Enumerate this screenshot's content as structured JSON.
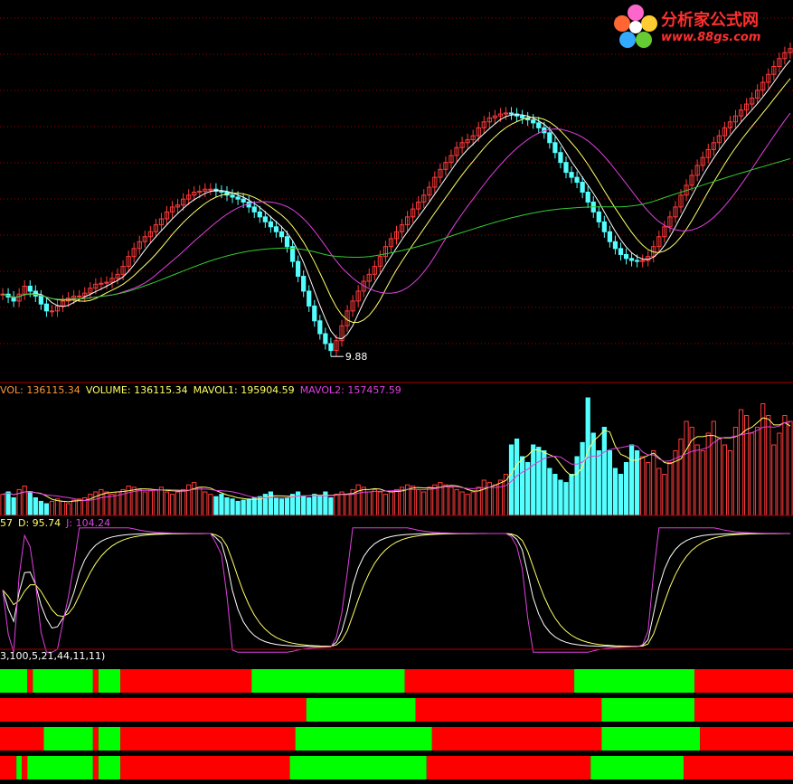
{
  "logo": {
    "title": "分析家公式网",
    "url": "www.88gs.com"
  },
  "colors": {
    "up": "#ff3b3b",
    "down": "#54ffff",
    "ma5": "#ffffff",
    "ma10": "#ffff66",
    "ma20": "#e040e0",
    "ma60": "#33cc33",
    "grid": "#a00000",
    "bar_red": "#ff0000",
    "bar_green": "#00ff00",
    "k": "#ffffff",
    "d": "#ffff66",
    "j": "#e040e0"
  },
  "price_panel": {
    "low_label": "9.88"
  },
  "volume_panel": {
    "header": [
      {
        "text": "VOL: 136115.34",
        "color": "#ff9933"
      },
      {
        "text": "VOLUME: 136115.34",
        "color": "#ffff66"
      },
      {
        "text": "MAVOL1: 195904.59",
        "color": "#ffff66"
      },
      {
        "text": "MAVOL2: 157457.59",
        "color": "#e040e0"
      }
    ]
  },
  "kdj_panel": {
    "header": [
      {
        "text": "57",
        "color": "#ffff66"
      },
      {
        "text": "D: 95.74",
        "color": "#ffff66"
      },
      {
        "text": "J: 104.24",
        "color": "#e040e0"
      }
    ]
  },
  "bar_panel": {
    "header": "3,100,5,21,44,11,11)"
  },
  "chart_data": [
    {
      "type": "candlestick",
      "x_count": 145,
      "annotation": "9.88",
      "series": [
        {
          "key": "closes"
        }
      ],
      "closes": [
        10.52,
        10.49,
        10.45,
        10.52,
        10.6,
        10.55,
        10.5,
        10.42,
        10.35,
        10.35,
        10.4,
        10.45,
        10.48,
        10.5,
        10.5,
        10.53,
        10.58,
        10.62,
        10.63,
        10.64,
        10.68,
        10.72,
        10.8,
        10.9,
        10.98,
        11.05,
        11.1,
        11.15,
        11.22,
        11.28,
        11.35,
        11.4,
        11.42,
        11.48,
        11.52,
        11.55,
        11.56,
        11.58,
        11.58,
        11.56,
        11.55,
        11.52,
        11.5,
        11.48,
        11.45,
        11.4,
        11.35,
        11.3,
        11.25,
        11.2,
        11.15,
        11.1,
        11.0,
        10.85,
        10.7,
        10.55,
        10.4,
        10.25,
        10.12,
        10.02,
        9.95,
        10.05,
        10.2,
        10.35,
        10.45,
        10.55,
        10.65,
        10.72,
        10.8,
        10.9,
        11.0,
        11.08,
        11.15,
        11.22,
        11.3,
        11.38,
        11.45,
        11.52,
        11.6,
        11.7,
        11.78,
        11.85,
        11.92,
        12.0,
        12.05,
        12.08,
        12.12,
        12.2,
        12.26,
        12.3,
        12.32,
        12.34,
        12.35,
        12.34,
        12.32,
        12.3,
        12.28,
        12.25,
        12.2,
        12.15,
        12.05,
        11.95,
        11.85,
        11.75,
        11.7,
        11.65,
        11.55,
        11.45,
        11.35,
        11.25,
        11.15,
        11.05,
        10.98,
        10.92,
        10.88,
        10.86,
        10.85,
        10.86,
        10.9,
        11.0,
        11.1,
        11.2,
        11.3,
        11.4,
        11.52,
        11.62,
        11.72,
        11.82,
        11.9,
        11.98,
        12.05,
        12.12,
        12.2,
        12.26,
        12.32,
        12.38,
        12.44,
        12.5,
        12.58,
        12.66,
        12.74,
        12.82,
        12.9,
        12.96,
        13.0
      ]
    },
    {
      "type": "bar",
      "x_count": 145,
      "series": [
        {
          "key": "volumes"
        }
      ],
      "volumes_note": "relative volume (0-1 of panel max)",
      "volumes": [
        0.18,
        0.2,
        0.15,
        0.22,
        0.25,
        0.2,
        0.15,
        0.12,
        0.1,
        0.12,
        0.14,
        0.12,
        0.1,
        0.13,
        0.14,
        0.15,
        0.18,
        0.2,
        0.22,
        0.2,
        0.18,
        0.2,
        0.22,
        0.25,
        0.24,
        0.22,
        0.2,
        0.21,
        0.22,
        0.24,
        0.2,
        0.18,
        0.2,
        0.22,
        0.26,
        0.28,
        0.24,
        0.2,
        0.18,
        0.16,
        0.18,
        0.15,
        0.14,
        0.12,
        0.13,
        0.14,
        0.15,
        0.16,
        0.18,
        0.2,
        0.15,
        0.14,
        0.15,
        0.18,
        0.2,
        0.16,
        0.15,
        0.18,
        0.17,
        0.2,
        0.15,
        0.18,
        0.2,
        0.18,
        0.22,
        0.26,
        0.24,
        0.2,
        0.22,
        0.2,
        0.18,
        0.2,
        0.22,
        0.24,
        0.26,
        0.25,
        0.22,
        0.2,
        0.24,
        0.26,
        0.28,
        0.26,
        0.24,
        0.22,
        0.2,
        0.18,
        0.2,
        0.24,
        0.3,
        0.28,
        0.26,
        0.3,
        0.35,
        0.6,
        0.65,
        0.5,
        0.45,
        0.6,
        0.58,
        0.55,
        0.4,
        0.35,
        0.3,
        0.28,
        0.35,
        0.5,
        0.62,
        1.0,
        0.7,
        0.55,
        0.75,
        0.55,
        0.4,
        0.35,
        0.45,
        0.6,
        0.55,
        0.5,
        0.45,
        0.55,
        0.4,
        0.35,
        0.45,
        0.55,
        0.65,
        0.8,
        0.75,
        0.6,
        0.55,
        0.7,
        0.8,
        0.65,
        0.6,
        0.55,
        0.75,
        0.9,
        0.85,
        0.7,
        0.75,
        0.95,
        0.85,
        0.6,
        0.7,
        0.85,
        0.8
      ]
    },
    {
      "type": "line",
      "x_count": 145,
      "ylim": [
        0,
        100
      ],
      "series": [
        {
          "key": "k"
        }
      ]
    },
    {
      "type": "heatmap",
      "rows": [
        [
          [
            0,
            5,
            "g"
          ],
          [
            5,
            6,
            "r"
          ],
          [
            6,
            17,
            "g"
          ],
          [
            17,
            18,
            "r"
          ],
          [
            18,
            22,
            "g"
          ],
          [
            22,
            46,
            "r"
          ],
          [
            46,
            74,
            "g"
          ],
          [
            74,
            105,
            "r"
          ],
          [
            105,
            127,
            "g"
          ],
          [
            127,
            145,
            "r"
          ]
        ],
        [
          [
            0,
            56,
            "r"
          ],
          [
            56,
            76,
            "g"
          ],
          [
            76,
            110,
            "r"
          ],
          [
            110,
            127,
            "g"
          ],
          [
            127,
            145,
            "r"
          ]
        ],
        [
          [
            0,
            8,
            "r"
          ],
          [
            8,
            17,
            "g"
          ],
          [
            17,
            18,
            "r"
          ],
          [
            18,
            22,
            "g"
          ],
          [
            22,
            54,
            "r"
          ],
          [
            54,
            79,
            "g"
          ],
          [
            79,
            110,
            "r"
          ],
          [
            110,
            128,
            "g"
          ],
          [
            128,
            145,
            "r"
          ]
        ],
        [
          [
            0,
            3,
            "r"
          ],
          [
            3,
            4,
            "g"
          ],
          [
            4,
            5,
            "r"
          ],
          [
            5,
            17,
            "g"
          ],
          [
            17,
            18,
            "r"
          ],
          [
            18,
            22,
            "g"
          ],
          [
            22,
            53,
            "r"
          ],
          [
            53,
            78,
            "g"
          ],
          [
            78,
            108,
            "r"
          ],
          [
            108,
            125,
            "g"
          ],
          [
            125,
            145,
            "r"
          ]
        ]
      ]
    }
  ]
}
